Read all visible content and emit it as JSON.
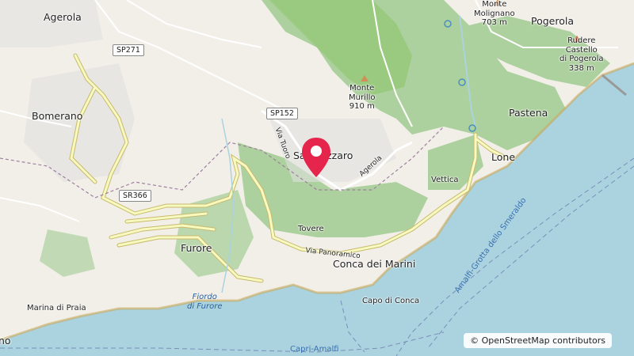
{
  "map": {
    "places": {
      "agerola": "Agerola",
      "bomerano": "Bomerano",
      "furore": "Furore",
      "tovere": "Tovere",
      "conca": "Conca dei Marini",
      "capo_conca": "Capo di Conca",
      "marina_praia": "Marina di Praia",
      "vettica": "Vettica",
      "lone": "Lone",
      "pastena": "Pastena",
      "pogerola": "Pogerola",
      "san_lazzaro": "San Lazzaro",
      "no_edge": "no"
    },
    "peaks": {
      "murillo_name": "Monte\nMurillo",
      "murillo_elev": "910 m",
      "molignano_name": "Monte\nMolignano",
      "molignano_elev": "703 m",
      "castello_name": "Rudere\nCastello\ndi Pogerola",
      "castello_elev": "338 m"
    },
    "roads": {
      "sp271": "SP271",
      "sp152": "SP152",
      "sr366": "SR366",
      "via_tuoro": "Via Tuoro",
      "via_panoramica": "Via Panoramico",
      "agerola_road": "Agerola"
    },
    "water": {
      "fiordo": "Fiordo\ndi Furore",
      "ferry_capri": "Capri-Amalfi",
      "ferry_grotta": "Amalfi-Grotta dello Smeraldo"
    },
    "attribution": "© OpenStreetMap contributors",
    "colors": {
      "sea": "#aad3df",
      "land": "#f2efe9",
      "forest": "#add19e",
      "dense_forest": "#8dc56c",
      "road_major": "#f7fabf",
      "road_casing": "#c9b96e",
      "marker": "#e5254b"
    },
    "icons": [
      "pin-marker-icon",
      "peak-icon",
      "ruin-icon",
      "spring-icon"
    ]
  }
}
